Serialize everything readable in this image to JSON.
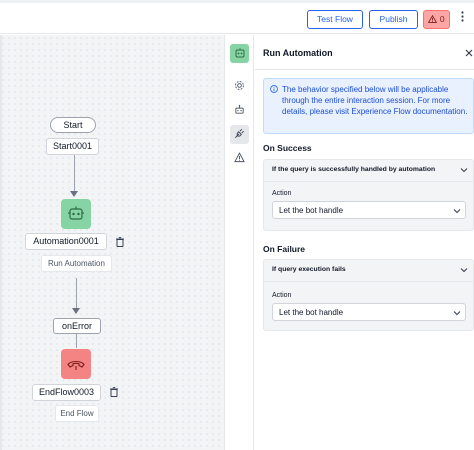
{
  "toolbar": {
    "test_flow_label": "Test Flow",
    "publish_label": "Publish",
    "warning_count": "0",
    "more_icon": "more-vertical-icon"
  },
  "canvas": {
    "start_pill": "Start",
    "start_node_label": "Start0001",
    "automation_node_label": "Automation0001",
    "automation_node_type": "Run Automation",
    "on_error_label": "onError",
    "end_node_label": "EndFlow0003",
    "end_node_type": "End Flow",
    "automation_icon_color": "#86d4a4",
    "end_icon_color": "#f48484"
  },
  "rail": {
    "items": [
      {
        "icon": "automation-icon",
        "active": true
      },
      {
        "icon": "settings-gear-icon"
      },
      {
        "icon": "bot-icon"
      },
      {
        "icon": "plug-connection-icon",
        "selected": true
      },
      {
        "icon": "warning-triangle-icon"
      }
    ]
  },
  "panel": {
    "title": "Run Automation",
    "info_text": "The behavior specified below will be applicable through the entire interaction session. For more details, please visit Experience Flow documentation.",
    "on_success": {
      "title": "On Success",
      "condition": "If the query is successfully handled by automation",
      "action_label": "Action",
      "action_value": "Let the bot handle"
    },
    "on_failure": {
      "title": "On Failure",
      "condition": "If query execution fails",
      "action_label": "Action",
      "action_value": "Let the bot handle"
    }
  }
}
